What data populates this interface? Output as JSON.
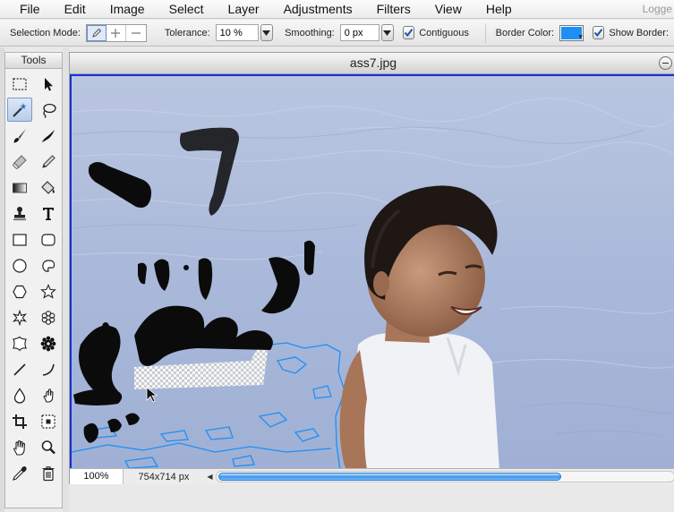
{
  "menubar": {
    "items": [
      "File",
      "Edit",
      "Image",
      "Select",
      "Layer",
      "Adjustments",
      "Filters",
      "View",
      "Help"
    ],
    "logged_text": "Logge"
  },
  "options": {
    "selection_mode_label": "Selection Mode:",
    "selection_modes": [
      "pencil-icon",
      "plus-icon",
      "minus-icon"
    ],
    "tolerance_label": "Tolerance:",
    "tolerance_value": "10 %",
    "smoothing_label": "Smoothing:",
    "smoothing_value": "0 px",
    "contiguous_label": "Contiguous",
    "contiguous_checked": true,
    "border_color_label": "Border Color:",
    "border_color": "#1f8ff5",
    "show_border_label": "Show Border:",
    "show_border_checked": true
  },
  "tools": {
    "title": "Tools",
    "active_tool": "magic-wand",
    "items": [
      "rect-marquee",
      "move",
      "magic-wand",
      "lasso",
      "brush",
      "smudge",
      "eraser",
      "pencil",
      "gradient",
      "fill-bucket",
      "clone-stamp",
      "text",
      "rectangle",
      "rounded-rectangle",
      "ellipse",
      "freeform",
      "polygon",
      "star",
      "star-burst",
      "flower",
      "blob",
      "gear-shape",
      "line",
      "curve",
      "blur-drop",
      "sponge",
      "crop",
      "resize",
      "hand",
      "zoom",
      "eyedropper",
      "trash"
    ]
  },
  "document": {
    "title": "ass7.jpg",
    "zoom": "100%",
    "dimensions": "754x714 px",
    "horizontal_scroll_fraction": 0.98
  }
}
